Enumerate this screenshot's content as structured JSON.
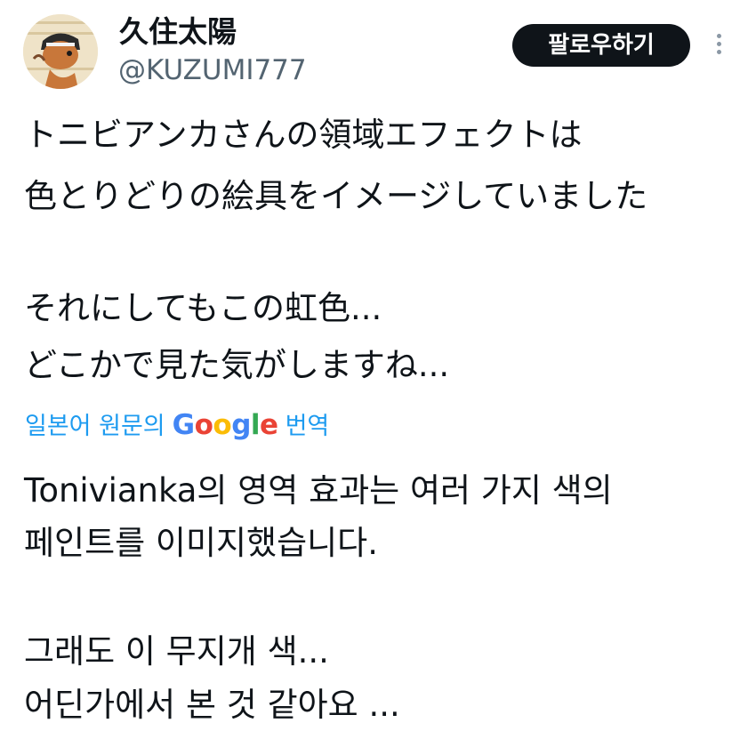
{
  "author": {
    "display_name": "久住太陽",
    "handle": "@KUZUMI777"
  },
  "actions": {
    "follow_label": "팔로우하기"
  },
  "tweet": {
    "original_lines": [
      "トニビアンカさんの領域エフェクトは",
      "色とりどりの絵具をイメージしていました",
      "それにしてもこの虹色...",
      "どこかで見た気がしますね..."
    ],
    "translation_label_prefix": "일본어 원문의",
    "translation_label_suffix": "번역",
    "google_logo_letters": [
      "G",
      "o",
      "o",
      "g",
      "l",
      "e"
    ],
    "translated_lines": [
      "Tonivianka의 영역 효과는 여러 가지 색의",
      "페인트를 이미지했습니다.",
      "그래도 이 무지개 색...",
      "어딘가에서 본 것 같아요 ..."
    ]
  },
  "colors": {
    "link": "#1d9bf0",
    "handle": "#536471",
    "google": [
      "#4285F4",
      "#EA4335",
      "#FBBC05",
      "#4285F4",
      "#34A853",
      "#EA4335"
    ]
  },
  "icons": {
    "more": "more-vertical-icon",
    "avatar": "avatar-illustration"
  }
}
